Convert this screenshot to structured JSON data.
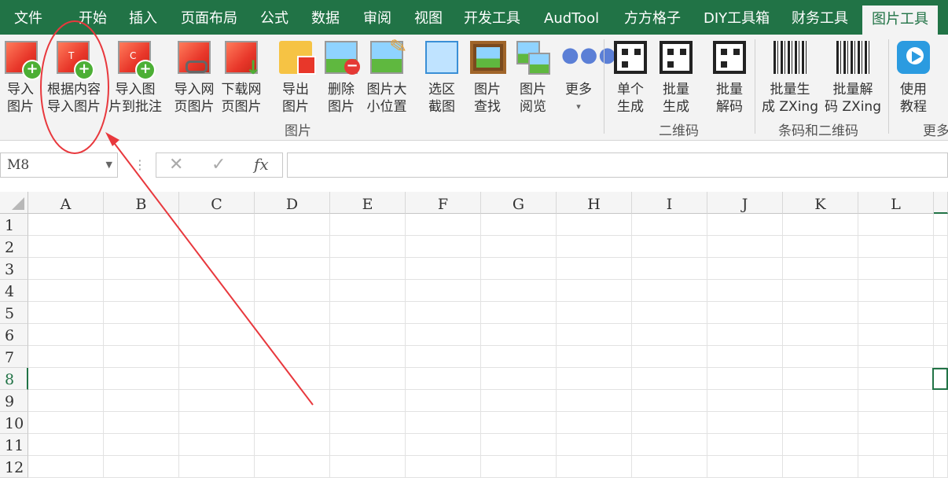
{
  "tabs": [
    "文件",
    "开始",
    "插入",
    "页面布局",
    "公式",
    "数据",
    "审阅",
    "视图",
    "开发工具",
    "AudTool",
    "方方格子",
    "DIY工具箱",
    "财务工具",
    "图片工具"
  ],
  "active_tab": "图片工具",
  "ribbon": {
    "buttons": [
      {
        "line1": "导入",
        "line2": "图片"
      },
      {
        "line1": "根据内容",
        "line2": "导入图片"
      },
      {
        "line1": "导入图",
        "line2": "片到批注"
      },
      {
        "line1": "导入网",
        "line2": "页图片"
      },
      {
        "line1": "下载网",
        "line2": "页图片"
      },
      {
        "line1": "导出",
        "line2": "图片"
      },
      {
        "line1": "删除",
        "line2": "图片"
      },
      {
        "line1": "图片大",
        "line2": "小位置"
      },
      {
        "line1": "选区",
        "line2": "截图"
      },
      {
        "line1": "图片",
        "line2": "查找"
      },
      {
        "line1": "图片",
        "line2": "阅览"
      },
      {
        "line1": "更多",
        "line2": "▾"
      },
      {
        "line1": "单个",
        "line2": "生成"
      },
      {
        "line1": "批量",
        "line2": "生成"
      },
      {
        "line1": "批量",
        "line2": "解码"
      },
      {
        "line1": "批量生",
        "line2": "成 ZXing"
      },
      {
        "line1": "批量解",
        "line2": "码 ZXing"
      },
      {
        "line1": "使用",
        "line2": "教程"
      }
    ],
    "groups": {
      "pictures": "图片",
      "qrcode": "二维码",
      "barcode": "条码和二维码",
      "more": "更多"
    }
  },
  "formula_bar": {
    "name_box": "M8",
    "cancel": "✕",
    "enter": "✓",
    "fx": "fx",
    "formula": ""
  },
  "grid": {
    "columns": [
      "A",
      "B",
      "C",
      "D",
      "E",
      "F",
      "G",
      "H",
      "I",
      "J",
      "K",
      "L"
    ],
    "rows": [
      "1",
      "2",
      "3",
      "4",
      "5",
      "6",
      "7",
      "8",
      "9",
      "10",
      "11",
      "12"
    ],
    "selected_row": "8"
  },
  "colors": {
    "accent": "#217346",
    "annotation": "#e8383d"
  }
}
